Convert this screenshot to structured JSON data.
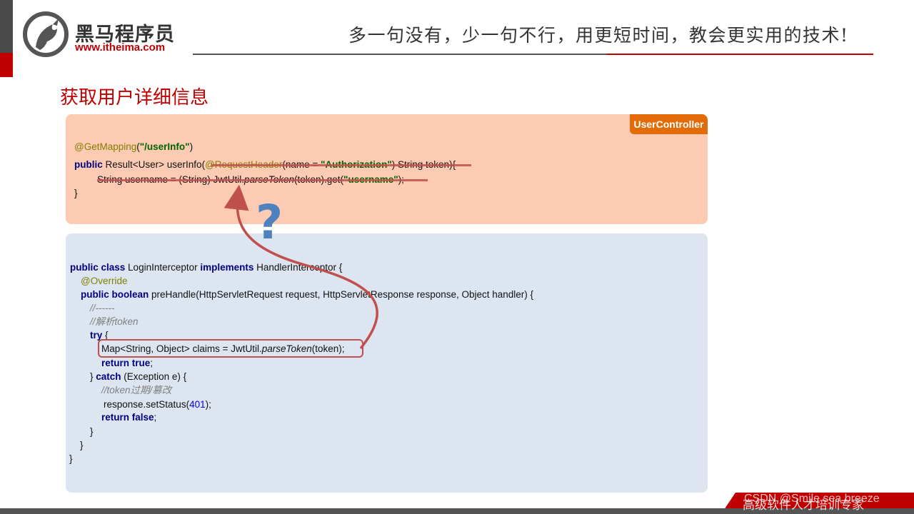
{
  "header": {
    "brand_cn": "黑马程序员",
    "brand_url": "www.itheima.com",
    "slogan": "多一句没有，少一句不行，用更短时间，教会更实用的技术!"
  },
  "page_title": "获取用户详细信息",
  "top_panel": {
    "tag": "UserController",
    "line1": {
      "annotation": "@GetMapping",
      "open": "(",
      "path": "\"/userInfo\"",
      "close": ")"
    },
    "line2": {
      "kw": "public",
      "sig": " Result<User> userInfo(",
      "ann": "@RequestHeader",
      "mid": "(name = ",
      "str": "\"Authorization\"",
      "rest": ") String token){"
    },
    "line3": {
      "pre": "String username = (String) JwtUtil.",
      "method": "parseToken",
      "mid": "(token).get(",
      "str": "\"username\"",
      "rest": ");"
    },
    "line4": "}"
  },
  "bottom_panel": {
    "l1": {
      "kw1": "public class",
      "name": " LoginInterceptor ",
      "kw2": "implements",
      "rest": " HandlerInterceptor {"
    },
    "l2": "@Override",
    "l3": {
      "kw": "public boolean",
      "rest": " preHandle(HttpServletRequest request, HttpServletResponse response, Object handler) {"
    },
    "l4": "//------",
    "l5": "//解析token",
    "l6": {
      "kw": "try",
      "rest": " {"
    },
    "l7": {
      "pre": "Map<String, Object> claims = JwtUtil.",
      "method": "parseToken",
      "rest": "(token);"
    },
    "l8": {
      "kw": "return true",
      "rest": ";"
    },
    "l9": {
      "pre": "} ",
      "kw": "catch",
      "rest": " (Exception e) {"
    },
    "l10": "//token过期/篡改",
    "l11": {
      "pre": "response.setStatus(",
      "num": "401",
      "rest": ");"
    },
    "l12": {
      "kw": "return false",
      "rest": ";"
    },
    "l13": "}",
    "l14": "}",
    "l15": "}"
  },
  "question_mark": "?",
  "footer": {
    "watermark": "CSDN @Smile sea breeze",
    "text": "高级软件人才培训专家"
  },
  "colors": {
    "brand_red": "#c00000",
    "tag_orange": "#e36c09",
    "top_panel": "#fdcbb3",
    "bottom_panel": "#dde5f0",
    "arrow": "#c0504d",
    "question": "#4f81bd"
  }
}
